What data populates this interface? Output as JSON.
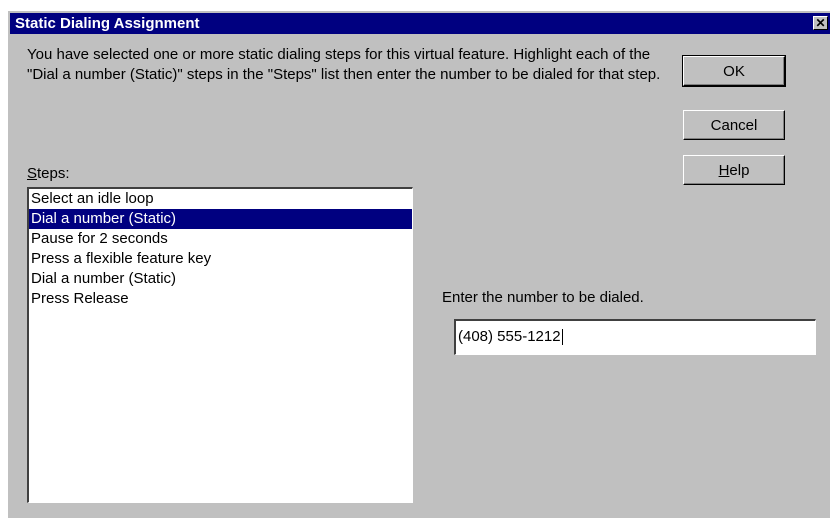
{
  "window": {
    "title": "Static Dialing Assignment",
    "close_glyph": "✕",
    "colors": {
      "titlebar": "#000080",
      "face": "#c0c0c0",
      "selection": "#000080"
    }
  },
  "instructions": "You have selected one or more static dialing steps for this virtual feature. Highlight each of the \"Dial a number (Static)\" steps in the \"Steps\" list then enter the number to be dialed for that step.",
  "buttons": {
    "ok": "OK",
    "cancel": "Cancel",
    "help_mnemonic": "H",
    "help_rest": "elp"
  },
  "steps": {
    "label_mnemonic": "S",
    "label_rest": "teps:",
    "items": [
      "Select an idle loop",
      "Dial a number (Static)",
      "Pause for 2 seconds",
      "Press a flexible feature key",
      "Dial a number (Static)",
      "Press Release"
    ],
    "selected_index": 1
  },
  "number": {
    "label": "Enter the number to be dialed.",
    "value": "(408) 555-1212"
  }
}
